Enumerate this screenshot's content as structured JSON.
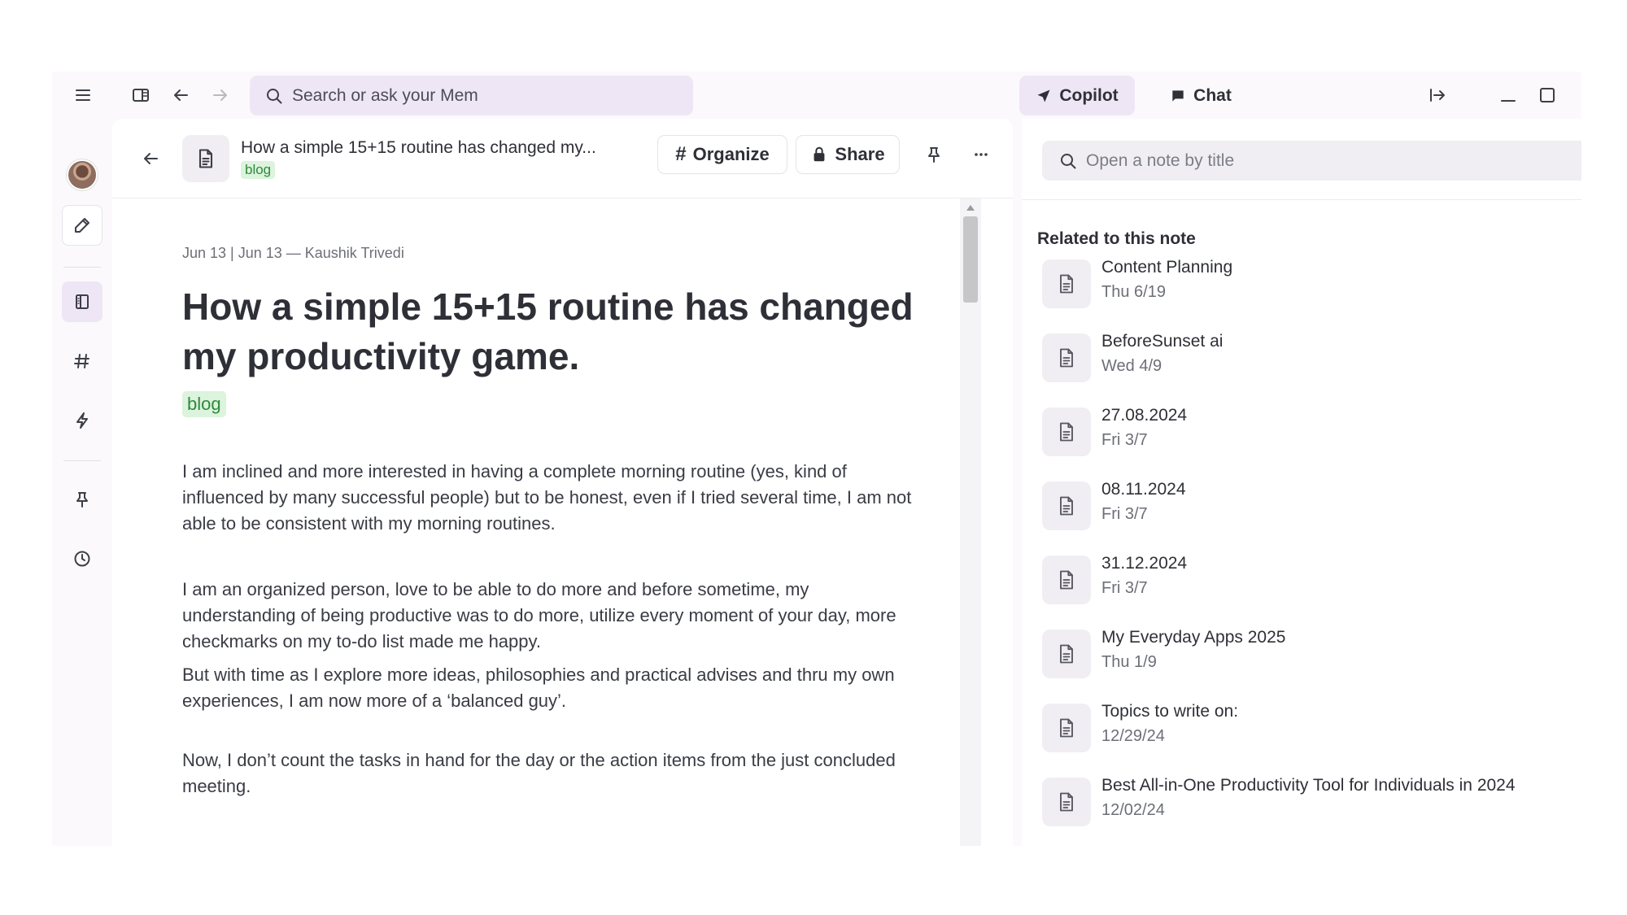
{
  "topbar": {
    "search_placeholder": "Search or ask your Mem",
    "copilot_label": "Copilot",
    "chat_label": "Chat"
  },
  "note": {
    "header_title": "How a simple 15+15 routine has changed my...",
    "header_tag": "blog",
    "organize_label": "Organize",
    "share_label": "Share",
    "meta": "Jun 13 | Jun 13 — Kaushik Trivedi",
    "title": "How a simple 15+15 routine has changed my productivity game.",
    "tag": "blog",
    "paragraphs": [
      "I am inclined and more interested in having a complete morning routine (yes, kind of influenced by many successful people) but to be honest, even if I tried several time, I am not able to be consistent with my morning routines.",
      "I am an organized person, love to be able to do more and before sometime, my understanding of being productive was to do more, utilize every moment of your day, more checkmarks on my to-do list made me happy.",
      "But with time as I explore more ideas, philosophies and practical advises and thru my own experiences, I am now more of a ‘balanced guy’.",
      "Now, I don’t count the tasks in hand for the day or the action items from the just concluded meeting."
    ]
  },
  "right_panel": {
    "search_placeholder": "Open a note by title",
    "related_heading": "Related to this note",
    "related": [
      {
        "title": "Content Planning",
        "date": "Thu 6/19"
      },
      {
        "title": "BeforeSunset ai",
        "date": "Wed 4/9"
      },
      {
        "title": "27.08.2024",
        "date": "Fri 3/7"
      },
      {
        "title": "08.11.2024",
        "date": "Fri 3/7"
      },
      {
        "title": "31.12.2024",
        "date": "Fri 3/7"
      },
      {
        "title": "My Everyday Apps 2025",
        "date": "Thu 1/9"
      },
      {
        "title": "Topics to write on:",
        "date": "12/29/24"
      },
      {
        "title": "Best All-in-One Productivity Tool for Individuals in 2024",
        "date": "12/02/24"
      }
    ]
  },
  "colors": {
    "accent_bg": "#efe6f5",
    "tag_bg": "#dcf3dd",
    "tag_text": "#2e8a3b"
  }
}
